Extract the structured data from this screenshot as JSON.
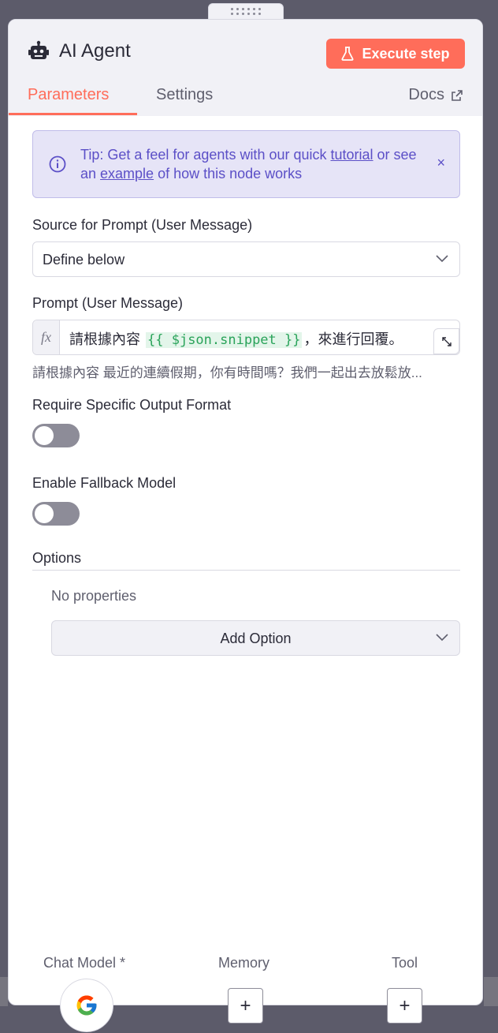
{
  "node": {
    "title": "AI Agent",
    "execute_label": "Execute step"
  },
  "tabs": {
    "parameters": "Parameters",
    "settings": "Settings",
    "docs": "Docs"
  },
  "tip": {
    "prefix": "Tip: Get a feel for agents with our quick ",
    "tutorial_link": "tutorial",
    "middle": " or see an ",
    "example_link": "example",
    "suffix": " of how this node works",
    "close": "×"
  },
  "source_prompt": {
    "label": "Source for Prompt (User Message)",
    "value": "Define below"
  },
  "prompt": {
    "label": "Prompt (User Message)",
    "fx": "fx",
    "text_before": "請根據內容 ",
    "expression": "{{ $json.snippet }}",
    "text_after": "，來進行回覆。",
    "preview": "請根據內容 最近的連續假期，你有時間嗎？我們一起出去放鬆放..."
  },
  "output_format": {
    "label": "Require Specific Output Format",
    "enabled": false
  },
  "fallback": {
    "label": "Enable Fallback Model",
    "enabled": false
  },
  "options": {
    "label": "Options",
    "empty_text": "No properties",
    "add_label": "Add Option"
  },
  "subnodes": {
    "chat_model": "Chat Model *",
    "memory": "Memory",
    "tool": "Tool",
    "plus": "+"
  },
  "colors": {
    "accent": "#ff6d5a",
    "tip_text": "#5b4fc7",
    "expression": "#2aa35a"
  }
}
